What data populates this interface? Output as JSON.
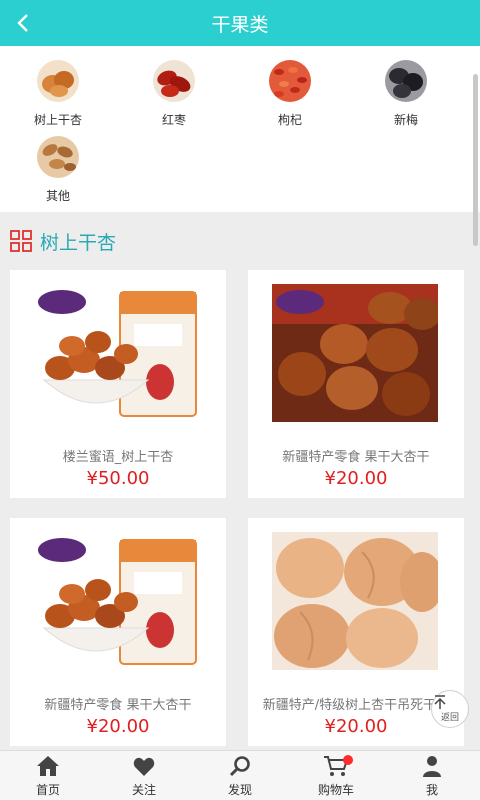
{
  "header": {
    "title": "干果类"
  },
  "categories": [
    {
      "label": "树上干杏"
    },
    {
      "label": "红枣"
    },
    {
      "label": "枸杞"
    },
    {
      "label": "新梅"
    },
    {
      "label": "其他"
    }
  ],
  "section": {
    "title": "树上干杏"
  },
  "products": [
    {
      "name": "楼兰蜜语_树上干杏",
      "price": "¥50.00"
    },
    {
      "name": "新疆特产零食 果干大杏干",
      "price": "¥20.00"
    },
    {
      "name": "新疆特产零食 果干大杏干",
      "price": "¥20.00"
    },
    {
      "name": "新疆特产/特级树上杏干吊死干杏",
      "price": "¥20.00"
    }
  ],
  "back_to_top": {
    "label": "返回"
  },
  "tabbar": [
    {
      "label": "首页"
    },
    {
      "label": "关注"
    },
    {
      "label": "发现"
    },
    {
      "label": "购物车"
    },
    {
      "label": "我"
    }
  ],
  "colors": {
    "header": "#2ccfcf",
    "accent": "#2aa9b3",
    "price": "#e02020"
  }
}
